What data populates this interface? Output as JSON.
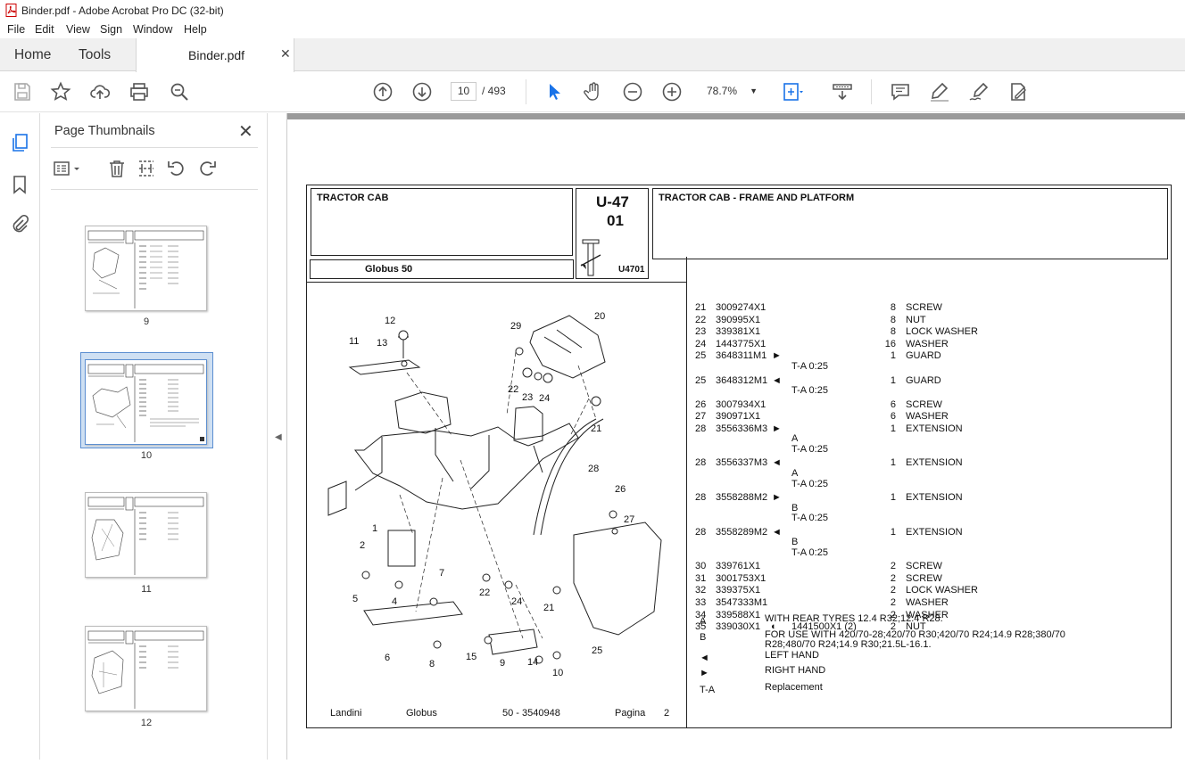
{
  "window": {
    "title": "Binder.pdf - Adobe Acrobat Pro DC (32-bit)"
  },
  "menu": [
    "File",
    "Edit",
    "View",
    "Sign",
    "Window",
    "Help"
  ],
  "tabs": {
    "home": "Home",
    "tools": "Tools",
    "document": "Binder.pdf"
  },
  "toolbar": {
    "page_current": "10",
    "page_total": "/ 493",
    "zoom": "78.7%"
  },
  "panel": {
    "title": "Page Thumbnails",
    "thumbnails": [
      "9",
      "10",
      "11",
      "12"
    ],
    "selected": "10"
  },
  "document": {
    "header_left": "TRACTOR CAB",
    "code_top": "U-47",
    "code_sub": "01",
    "code_fig": "U4701",
    "header_right": "TRACTOR CAB - FRAME AND PLATFORM",
    "model": "Globus 50",
    "parts": [
      {
        "ref": "21",
        "part": "3009274X1",
        "qty": "8",
        "desc": "SCREW"
      },
      {
        "ref": "22",
        "part": "390995X1",
        "qty": "8",
        "desc": "NUT"
      },
      {
        "ref": "23",
        "part": "339381X1",
        "qty": "8",
        "desc": "LOCK WASHER"
      },
      {
        "ref": "24",
        "part": "1443775X1",
        "qty": "16",
        "desc": "WASHER"
      },
      {
        "ref": "25",
        "part": "3648311M1",
        "mark": "►",
        "qty": "1",
        "desc": "GUARD",
        "notes": [
          "T-A 0:25"
        ]
      },
      {
        "ref": "25",
        "part": "3648312M1",
        "mark": "◄",
        "qty": "1",
        "desc": "GUARD",
        "notes": [
          "T-A 0:25"
        ]
      },
      {
        "ref": "26",
        "part": "3007934X1",
        "qty": "6",
        "desc": "SCREW"
      },
      {
        "ref": "27",
        "part": "390971X1",
        "qty": "6",
        "desc": "WASHER"
      },
      {
        "ref": "28",
        "part": "3556336M3",
        "mark": "►",
        "qty": "1",
        "desc": "EXTENSION",
        "notes": [
          "A",
          "T-A 0:25"
        ]
      },
      {
        "ref": "28",
        "part": "3556337M3",
        "mark": "◄",
        "qty": "1",
        "desc": "EXTENSION",
        "notes": [
          "A",
          "T-A 0:25"
        ]
      },
      {
        "ref": "28",
        "part": "3558288M2",
        "mark": "►",
        "qty": "1",
        "desc": "EXTENSION",
        "notes": [
          "B",
          "T-A 0:25"
        ]
      },
      {
        "ref": "28",
        "part": "3558289M2",
        "mark": "◄",
        "qty": "1",
        "desc": "EXTENSION",
        "notes": [
          "B",
          "T-A 0:25"
        ]
      },
      {
        "ref": "30",
        "part": "339761X1",
        "qty": "2",
        "desc": "SCREW"
      },
      {
        "ref": "31",
        "part": "3001753X1",
        "qty": "2",
        "desc": "SCREW"
      },
      {
        "ref": "32",
        "part": "339375X1",
        "qty": "2",
        "desc": "LOCK WASHER"
      },
      {
        "ref": "33",
        "part": "3547333M1",
        "qty": "2",
        "desc": "WASHER"
      },
      {
        "ref": "34",
        "part": "339588X1",
        "qty": "2",
        "desc": "WASHER"
      },
      {
        "ref": "35",
        "part": "339030X1",
        "mark": "◐",
        "extra": "1441500X1  (2)",
        "qty": "2",
        "desc": "NUT"
      }
    ],
    "legend": [
      {
        "key": "A",
        "text": "WITH REAR TYRES 12.4 R32;12.4 R28."
      },
      {
        "key": "B",
        "text": "FOR USE WITH 420/70-28;420/70 R30;420/70 R24;14.9 R28;380/70",
        "text2": "R28;480/70 R24;14.9 R30;21.5L-16.1."
      },
      {
        "key": "◄",
        "text": "LEFT HAND"
      },
      {
        "key": "►",
        "text": "RIGHT HAND"
      },
      {
        "key": "T-A",
        "text": "Replacement"
      }
    ],
    "footer": {
      "brand": "Landini",
      "model": "Globus",
      "code": "50 - 3540948",
      "page_label": "Pagina",
      "page_no": "2"
    },
    "callouts": [
      "1",
      "2",
      "4",
      "5",
      "6",
      "7",
      "8",
      "9",
      "10",
      "11",
      "12",
      "13",
      "14",
      "15",
      "20",
      "21",
      "22",
      "23",
      "24",
      "25",
      "26",
      "27",
      "28",
      "29"
    ]
  },
  "icons": [
    "pdf-app-icon",
    "save-icon",
    "star-icon",
    "upload-icon",
    "print-icon",
    "zoom-search-icon",
    "prev-page-icon",
    "next-page-icon",
    "select-arrow-icon",
    "hand-icon",
    "zoom-out-icon",
    "zoom-in-icon",
    "fit-page-icon",
    "scroll-mode-icon",
    "comment-icon",
    "highlight-icon",
    "sign-icon",
    "redact-icon",
    "thumbnails-icon",
    "bookmark-icon",
    "attachment-icon"
  ]
}
